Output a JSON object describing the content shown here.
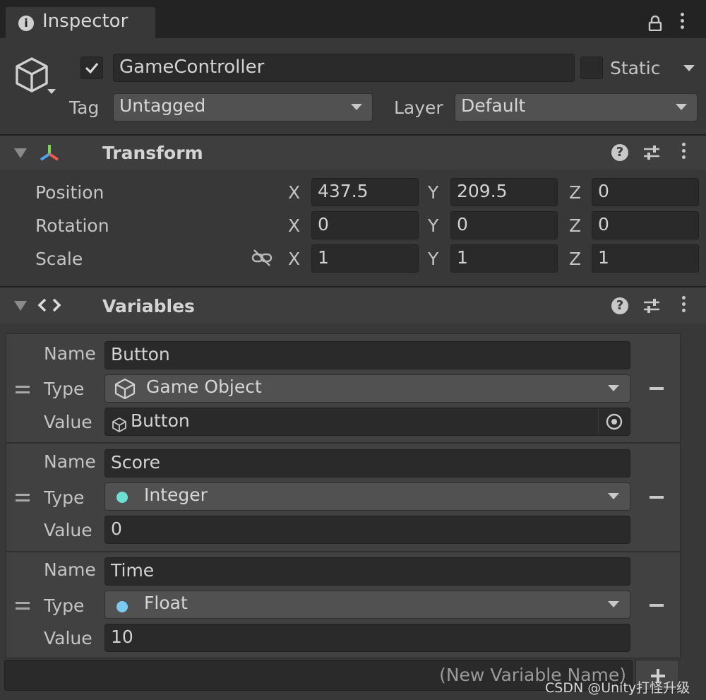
{
  "tab": {
    "title": "Inspector"
  },
  "gameobject": {
    "name": "GameController",
    "active_checked": true,
    "static_label": "Static",
    "tag_label": "Tag",
    "tag_value": "Untagged",
    "layer_label": "Layer",
    "layer_value": "Default"
  },
  "transform": {
    "title": "Transform",
    "rows": [
      {
        "label": "Position",
        "x": "437.5",
        "y": "209.5",
        "z": "0"
      },
      {
        "label": "Rotation",
        "x": "0",
        "y": "0",
        "z": "0"
      },
      {
        "label": "Scale",
        "x": "1",
        "y": "1",
        "z": "1"
      }
    ],
    "axis": {
      "x": "X",
      "y": "Y",
      "z": "Z"
    }
  },
  "variables": {
    "title": "Variables",
    "labels": {
      "name": "Name",
      "type": "Type",
      "value": "Value"
    },
    "items": [
      {
        "name": "Button",
        "type": "Game Object",
        "value": "Button"
      },
      {
        "name": "Score",
        "type": "Integer",
        "value": "0",
        "type_color": "#6de0d2"
      },
      {
        "name": "Time",
        "type": "Float",
        "value": "10",
        "type_color": "#7cc9f2"
      }
    ],
    "new_placeholder": "(New Variable Name)"
  },
  "watermark": "CSDN @Unity打怪升级"
}
